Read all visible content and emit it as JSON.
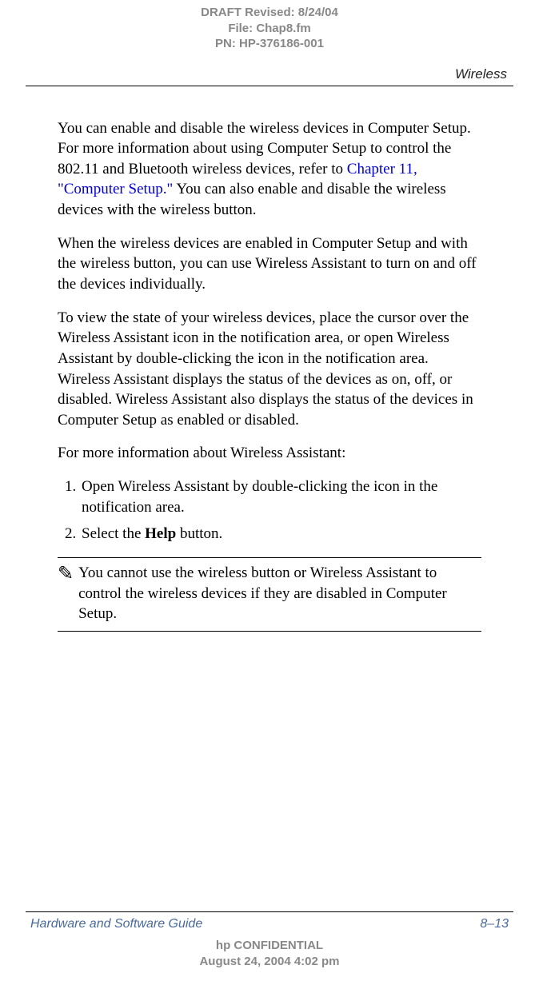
{
  "header": {
    "draft_line1": "DRAFT Revised: 8/24/04",
    "draft_line2": "File: Chap8.fm",
    "draft_line3": "PN: HP-376186-001",
    "section": "Wireless"
  },
  "body": {
    "p1_before_link": "You can enable and disable the wireless devices in Computer Setup. For more information about using Computer Setup to control the 802.11 and Bluetooth wireless devices, refer to ",
    "p1_link": "Chapter 11, \"Computer Setup.\"",
    "p1_after_link": " You can also enable and disable the wireless devices with the wireless button.",
    "p2": "When the wireless devices are enabled in Computer Setup and with the wireless button, you can use Wireless Assistant to turn on and off the devices individually.",
    "p3": "To view the state of your wireless devices, place the cursor over the Wireless Assistant icon in the notification area, or open Wireless Assistant by double-clicking the icon in the notification area. Wireless Assistant displays the status of the devices as on, off, or disabled. Wireless Assistant also displays the status of the devices in Computer Setup as enabled or disabled.",
    "p4": "For more information about Wireless Assistant:",
    "list_item1": "Open Wireless Assistant by double-clicking the icon in the notification area.",
    "list_item2_before": "Select the ",
    "list_item2_bold": "Help",
    "list_item2_after": " button.",
    "note_icon": "✎",
    "note_text": "You cannot use the wireless button or Wireless Assistant to control the wireless devices if they are disabled in Computer Setup."
  },
  "footer": {
    "guide_title": "Hardware and Software Guide",
    "page_number": "8–13",
    "confidential_line1": "hp CONFIDENTIAL",
    "confidential_line2": "August 24, 2004 4:02 pm"
  }
}
